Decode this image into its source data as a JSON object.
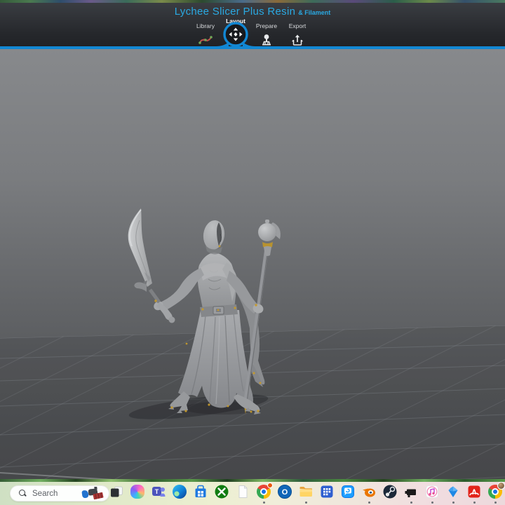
{
  "app": {
    "title": "Lychee Slicer Plus Resin",
    "title_suffix": "& Filament",
    "accent_color": "#1287d3",
    "title_color": "#2aa9e2"
  },
  "tabs": [
    {
      "label": "Library",
      "icon": "spline-curve-icon",
      "active": false
    },
    {
      "label": "Layout",
      "icon": "move-arrows-icon",
      "active": true
    },
    {
      "label": "Prepare",
      "icon": "supports-icon",
      "active": false
    },
    {
      "label": "Export",
      "icon": "export-box-icon",
      "active": false
    }
  ],
  "viewport": {
    "content": "3d-build-plate-with-hooded-figure-miniature-holding-curved-sword-and-orb-staff",
    "background_top": "#87898c",
    "background_bottom": "#4c4e51",
    "model_color": "#a3a5a8",
    "overhang_accent_color": "#c59a2d",
    "grid_line_color": "#9599a0"
  },
  "taskbar": {
    "search": {
      "placeholder": "Search",
      "thumbnail": "bing-daily-image"
    },
    "running_dot_color": "#6b7075",
    "icons": [
      {
        "name": "task-view",
        "running": false
      },
      {
        "name": "copilot",
        "running": false
      },
      {
        "name": "teams",
        "running": false
      },
      {
        "name": "edge",
        "running": false
      },
      {
        "name": "microsoft-store",
        "running": false
      },
      {
        "name": "xbox",
        "running": false
      },
      {
        "name": "notepad",
        "running": false
      },
      {
        "name": "chrome",
        "running": true
      },
      {
        "name": "outlook",
        "running": false
      },
      {
        "name": "file-explorer",
        "running": true
      },
      {
        "name": "app-grid",
        "running": false
      },
      {
        "name": "chat-app",
        "running": false
      },
      {
        "name": "blender",
        "running": true
      },
      {
        "name": "steam",
        "running": false
      },
      {
        "name": "capture-device",
        "running": true
      },
      {
        "name": "itunes",
        "running": true
      },
      {
        "name": "blue-gem",
        "running": true
      },
      {
        "name": "acrobat",
        "running": true
      },
      {
        "name": "chrome-profile",
        "running": true
      }
    ]
  }
}
